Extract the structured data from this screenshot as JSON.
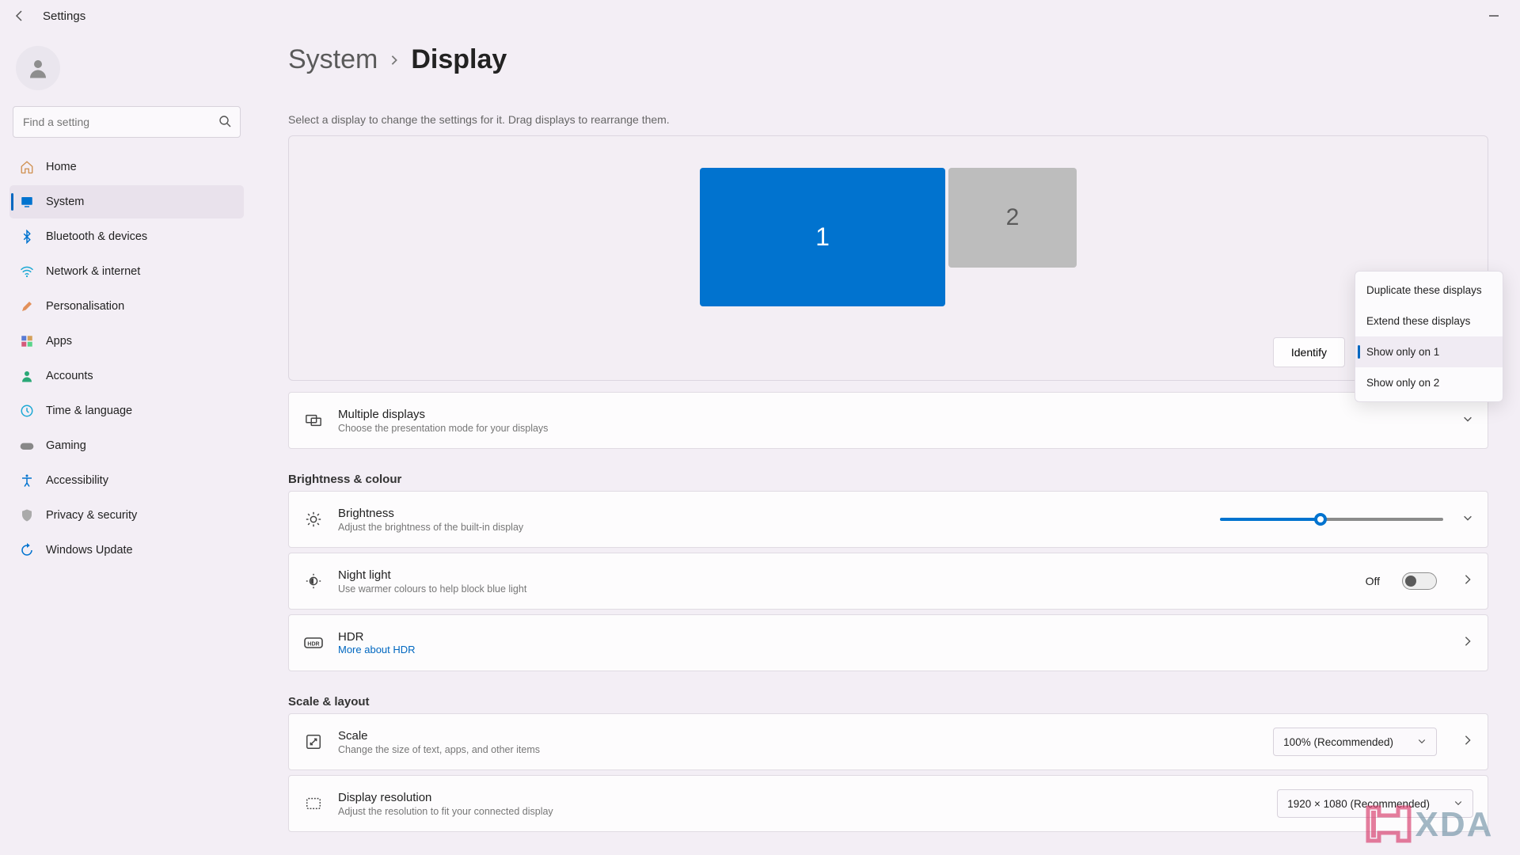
{
  "titlebar": {
    "title": "Settings"
  },
  "sidebar": {
    "search_placeholder": "Find a setting",
    "items": [
      {
        "label": "Home",
        "icon": "home"
      },
      {
        "label": "System",
        "icon": "system",
        "active": true
      },
      {
        "label": "Bluetooth & devices",
        "icon": "bluetooth"
      },
      {
        "label": "Network & internet",
        "icon": "wifi"
      },
      {
        "label": "Personalisation",
        "icon": "brush"
      },
      {
        "label": "Apps",
        "icon": "apps"
      },
      {
        "label": "Accounts",
        "icon": "person"
      },
      {
        "label": "Time & language",
        "icon": "clock"
      },
      {
        "label": "Gaming",
        "icon": "gamepad"
      },
      {
        "label": "Accessibility",
        "icon": "accessibility"
      },
      {
        "label": "Privacy & security",
        "icon": "shield"
      },
      {
        "label": "Windows Update",
        "icon": "update"
      }
    ]
  },
  "breadcrumb": {
    "parent": "System",
    "current": "Display"
  },
  "instruction": "Select a display to change the settings for it. Drag displays to rearrange them.",
  "monitors": {
    "1": "1",
    "2": "2"
  },
  "identify_button": "Identify",
  "arrangement_dropdown": {
    "options": [
      "Duplicate these displays",
      "Extend these displays",
      "Show only on 1",
      "Show only on 2"
    ],
    "selected_index": 2
  },
  "cards": {
    "multiple": {
      "title": "Multiple displays",
      "sub": "Choose the presentation mode for your displays"
    }
  },
  "section_brightness": "Brightness & colour",
  "brightness": {
    "title": "Brightness",
    "sub": "Adjust the brightness of the built-in display",
    "percent": 45
  },
  "nightlight": {
    "title": "Night light",
    "sub": "Use warmer colours to help block blue light",
    "state": "Off"
  },
  "hdr": {
    "title": "HDR",
    "link": "More about HDR"
  },
  "section_scale": "Scale & layout",
  "scale": {
    "title": "Scale",
    "sub": "Change the size of text, apps, and other items",
    "value": "100% (Recommended)"
  },
  "resolution": {
    "title": "Display resolution",
    "sub": "Adjust the resolution to fit your connected display",
    "value": "1920 × 1080 (Recommended)"
  },
  "watermark": "XDA"
}
